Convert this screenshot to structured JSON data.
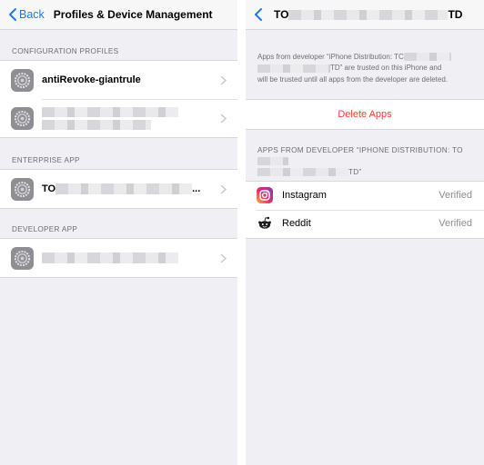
{
  "left": {
    "nav": {
      "back_label": "Back",
      "title": "Profiles & Device Management"
    },
    "sections": {
      "configuration_profiles": "CONFIGURATION PROFILES",
      "enterprise_app": "ENTERPRISE APP",
      "developer_app": "DEVELOPER APP"
    },
    "rows": {
      "profile_1": "antiRevoke-giantrule",
      "enterprise_prefix": "TO",
      "enterprise_suffix": "..."
    }
  },
  "right": {
    "nav": {
      "title_prefix": "TO",
      "title_suffix": "TD"
    },
    "info_line1": "Apps from developer “iPhone Distribution: TC",
    "info_line2_suffix": "TD” are trusted on this iPhone and",
    "info_line3": "will be trusted until all apps from the developer are deleted.",
    "delete_label": "Delete Apps",
    "apps_header_prefix": "APPS FROM DEVELOPER “IPHONE DISTRIBUTION: TO",
    "apps_header_suffix": "TD”",
    "apps": [
      {
        "name": "Instagram",
        "status": "Verified",
        "icon": "instagram-icon"
      },
      {
        "name": "Reddit",
        "status": "Verified",
        "icon": "reddit-icon"
      }
    ]
  },
  "colors": {
    "accent": "#1a7cf5",
    "destructive": "#ff3b30",
    "background": "#efeff4"
  }
}
